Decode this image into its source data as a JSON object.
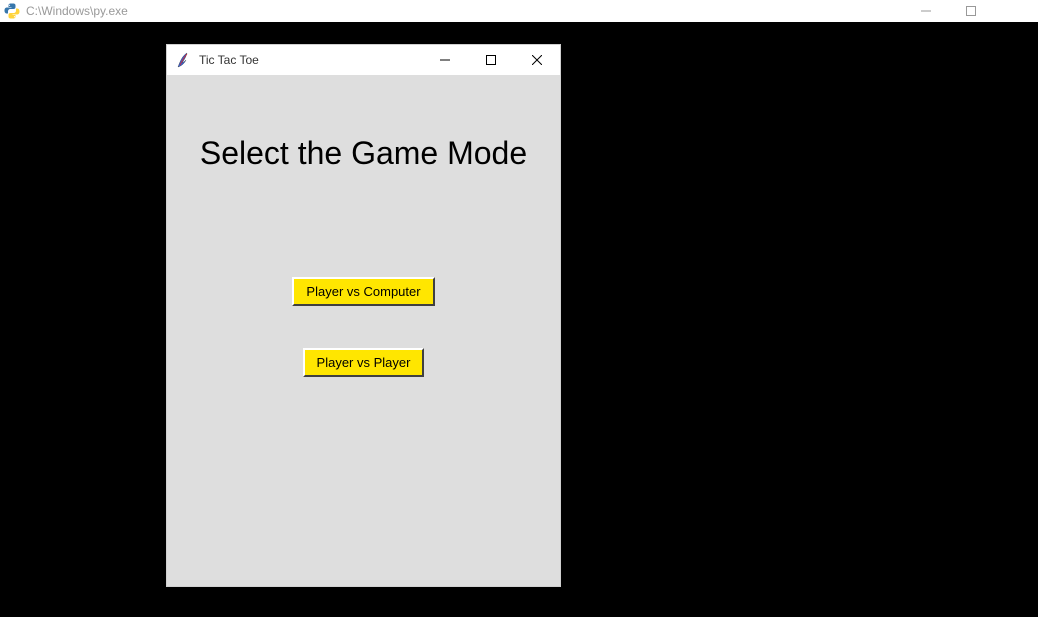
{
  "outer_window": {
    "title": "C:\\Windows\\py.exe"
  },
  "tk_window": {
    "title": "Tic Tac Toe",
    "heading": "Select the Game Mode",
    "buttons": {
      "pvc": "Player vs Computer",
      "pvp": "Player vs Player"
    }
  }
}
